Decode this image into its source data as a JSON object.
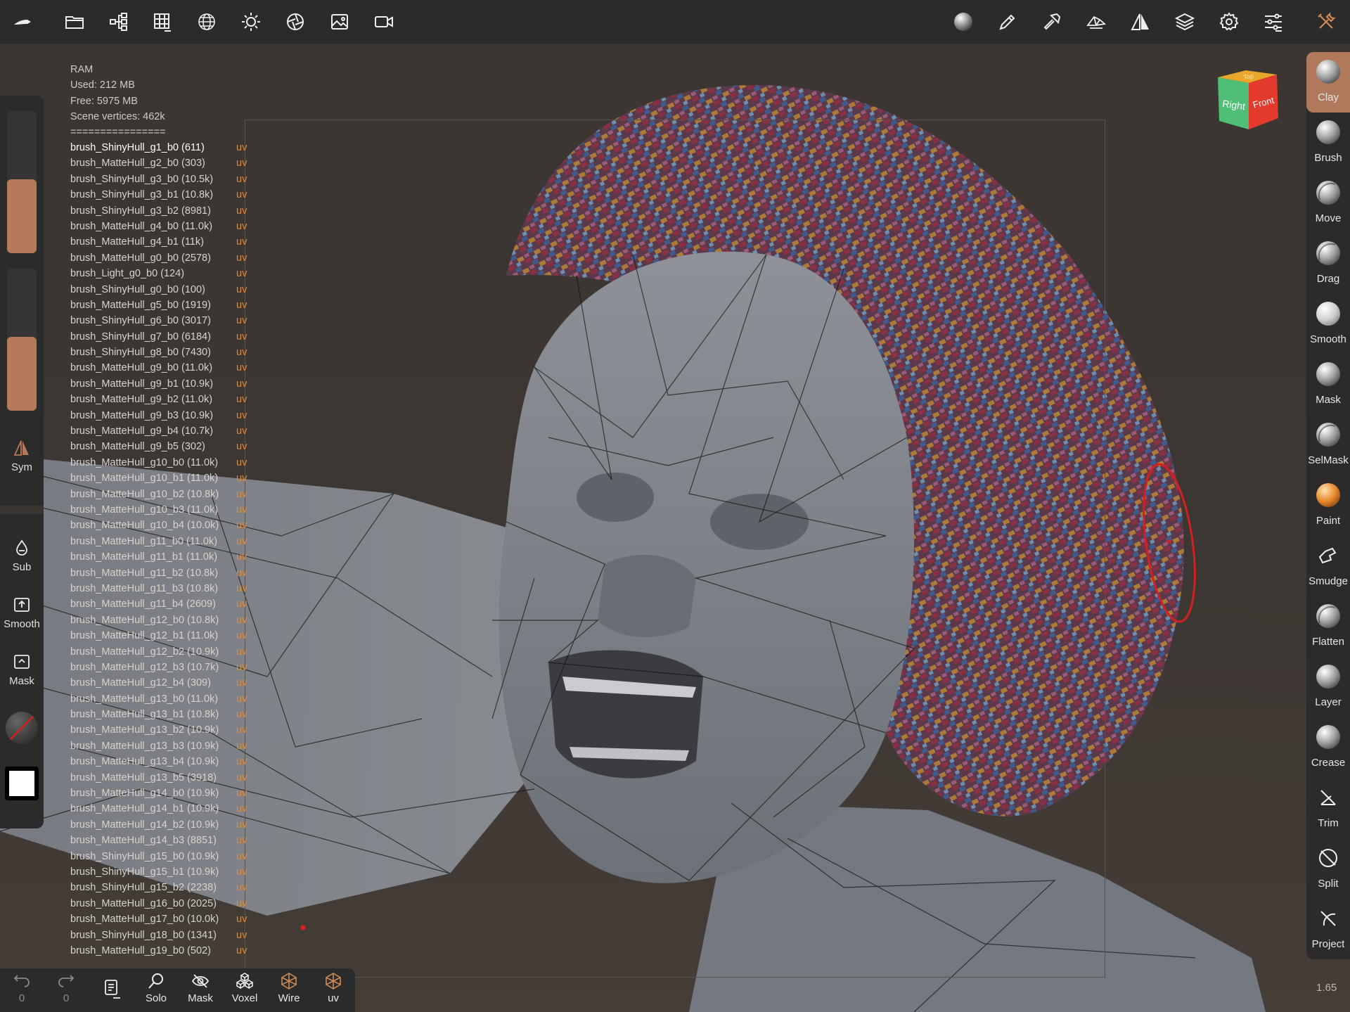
{
  "topbar": {
    "left_icons": [
      "nomad-logo-icon",
      "folder-icon",
      "scene-tree-icon",
      "grid-icon",
      "sphere-icon",
      "sun-icon",
      "aperture-icon",
      "image-icon",
      "video-camera-icon"
    ],
    "right_icons": [
      "matcap-sphere-icon",
      "pen-icon",
      "hammer-icon",
      "topology-icon",
      "symmetry-icon",
      "layers-icon",
      "gear-icon",
      "sliders-icon",
      "tools-icon"
    ]
  },
  "info": {
    "ram_label": "RAM",
    "used": "Used: 212 MB",
    "free": "Free: 5975 MB",
    "vertices": "Scene vertices: 462k",
    "separator": "================"
  },
  "meshes": [
    {
      "name": "brush_ShinyHull_g1_b0 (611)",
      "tag": "uv"
    },
    {
      "name": "brush_MatteHull_g2_b0 (303)",
      "tag": "uv"
    },
    {
      "name": "brush_ShinyHull_g3_b0 (10.5k)",
      "tag": "uv"
    },
    {
      "name": "brush_ShinyHull_g3_b1 (10.8k)",
      "tag": "uv"
    },
    {
      "name": "brush_ShinyHull_g3_b2 (8981)",
      "tag": "uv"
    },
    {
      "name": "brush_MatteHull_g4_b0 (11.0k)",
      "tag": "uv"
    },
    {
      "name": "brush_MatteHull_g4_b1 (11k)",
      "tag": "uv"
    },
    {
      "name": "brush_MatteHull_g0_b0 (2578)",
      "tag": "uv"
    },
    {
      "name": "brush_Light_g0_b0 (124)",
      "tag": "uv"
    },
    {
      "name": "brush_ShinyHull_g0_b0 (100)",
      "tag": "uv"
    },
    {
      "name": "brush_MatteHull_g5_b0 (1919)",
      "tag": "uv"
    },
    {
      "name": "brush_ShinyHull_g6_b0 (3017)",
      "tag": "uv"
    },
    {
      "name": "brush_ShinyHull_g7_b0 (6184)",
      "tag": "uv"
    },
    {
      "name": "brush_ShinyHull_g8_b0 (7430)",
      "tag": "uv"
    },
    {
      "name": "brush_MatteHull_g9_b0 (11.0k)",
      "tag": "uv"
    },
    {
      "name": "brush_MatteHull_g9_b1 (10.9k)",
      "tag": "uv"
    },
    {
      "name": "brush_MatteHull_g9_b2 (11.0k)",
      "tag": "uv"
    },
    {
      "name": "brush_MatteHull_g9_b3 (10.9k)",
      "tag": "uv"
    },
    {
      "name": "brush_MatteHull_g9_b4 (10.7k)",
      "tag": "uv"
    },
    {
      "name": "brush_MatteHull_g9_b5 (302)",
      "tag": "uv"
    },
    {
      "name": "brush_MatteHull_g10_b0 (11.0k)",
      "tag": "uv"
    },
    {
      "name": "brush_MatteHull_g10_b1 (11.0k)",
      "tag": "uv"
    },
    {
      "name": "brush_MatteHull_g10_b2 (10.8k)",
      "tag": "uv"
    },
    {
      "name": "brush_MatteHull_g10_b3 (11.0k)",
      "tag": "uv"
    },
    {
      "name": "brush_MatteHull_g10_b4 (10.0k)",
      "tag": "uv"
    },
    {
      "name": "brush_MatteHull_g11_b0 (11.0k)",
      "tag": "uv"
    },
    {
      "name": "brush_MatteHull_g11_b1 (11.0k)",
      "tag": "uv"
    },
    {
      "name": "brush_MatteHull_g11_b2 (10.8k)",
      "tag": "uv"
    },
    {
      "name": "brush_MatteHull_g11_b3 (10.8k)",
      "tag": "uv"
    },
    {
      "name": "brush_MatteHull_g11_b4 (2609)",
      "tag": "uv"
    },
    {
      "name": "brush_MatteHull_g12_b0 (10.8k)",
      "tag": "uv"
    },
    {
      "name": "brush_MatteHull_g12_b1 (11.0k)",
      "tag": "uv"
    },
    {
      "name": "brush_MatteHull_g12_b2 (10.9k)",
      "tag": "uv"
    },
    {
      "name": "brush_MatteHull_g12_b3 (10.7k)",
      "tag": "uv"
    },
    {
      "name": "brush_MatteHull_g12_b4 (309)",
      "tag": "uv"
    },
    {
      "name": "brush_MatteHull_g13_b0 (11.0k)",
      "tag": "uv"
    },
    {
      "name": "brush_MatteHull_g13_b1 (10.8k)",
      "tag": "uv"
    },
    {
      "name": "brush_MatteHull_g13_b2 (10.9k)",
      "tag": "uv"
    },
    {
      "name": "brush_MatteHull_g13_b3 (10.9k)",
      "tag": "uv"
    },
    {
      "name": "brush_MatteHull_g13_b4 (10.9k)",
      "tag": "uv"
    },
    {
      "name": "brush_MatteHull_g13_b5 (3918)",
      "tag": "uv"
    },
    {
      "name": "brush_MatteHull_g14_b0 (10.9k)",
      "tag": "uv"
    },
    {
      "name": "brush_MatteHull_g14_b1 (10.9k)",
      "tag": "uv"
    },
    {
      "name": "brush_MatteHull_g14_b2 (10.9k)",
      "tag": "uv"
    },
    {
      "name": "brush_MatteHull_g14_b3 (8851)",
      "tag": "uv"
    },
    {
      "name": "brush_ShinyHull_g15_b0 (10.9k)",
      "tag": "uv"
    },
    {
      "name": "brush_ShinyHull_g15_b1 (10.9k)",
      "tag": "uv"
    },
    {
      "name": "brush_ShinyHull_g15_b2 (2238)",
      "tag": "uv"
    },
    {
      "name": "brush_MatteHull_g16_b0 (2025)",
      "tag": "uv"
    },
    {
      "name": "brush_MatteHull_g17_b0 (10.0k)",
      "tag": "uv"
    },
    {
      "name": "brush_ShinyHull_g18_b0 (1341)",
      "tag": "uv"
    },
    {
      "name": "brush_MatteHull_g19_b0 (502)",
      "tag": "uv"
    }
  ],
  "left_panel": {
    "radius_level": 0.52,
    "intensity_level": 0.52,
    "sym_label": "Sym",
    "sub_label": "Sub",
    "smooth_label": "Smooth",
    "mask_label": "Mask",
    "accent_color": "#b57a5a"
  },
  "tools": [
    {
      "label": "Clay",
      "icon": "clay-sphere-icon",
      "active": true
    },
    {
      "label": "Brush",
      "icon": "brush-sphere-icon",
      "active": false
    },
    {
      "label": "Move",
      "icon": "move-sphere-icon",
      "active": false
    },
    {
      "label": "Drag",
      "icon": "drag-sphere-icon",
      "active": false
    },
    {
      "label": "Smooth",
      "icon": "smooth-sphere-icon",
      "active": false
    },
    {
      "label": "Mask",
      "icon": "mask-sphere-icon",
      "active": false
    },
    {
      "label": "SelMask",
      "icon": "selmask-sphere-icon",
      "active": false
    },
    {
      "label": "Paint",
      "icon": "paint-sphere-icon",
      "active": false
    },
    {
      "label": "Smudge",
      "icon": "smudge-icon",
      "active": false
    },
    {
      "label": "Flatten",
      "icon": "flatten-sphere-icon",
      "active": false
    },
    {
      "label": "Layer",
      "icon": "layer-sphere-icon",
      "active": false
    },
    {
      "label": "Crease",
      "icon": "crease-sphere-icon",
      "active": false
    },
    {
      "label": "Trim",
      "icon": "trim-icon",
      "active": false
    },
    {
      "label": "Split",
      "icon": "split-icon",
      "active": false
    },
    {
      "label": "Project",
      "icon": "project-icon",
      "active": false
    }
  ],
  "bottom": {
    "undo_count": "0",
    "redo_count": "0",
    "solo_label": "Solo",
    "mask_label": "Mask",
    "voxel_label": "Voxel",
    "wire_label": "Wire",
    "uv_label": "uv"
  },
  "view_cube": {
    "top": "Top",
    "right": "Right",
    "front": "Front"
  },
  "version": "1.65"
}
